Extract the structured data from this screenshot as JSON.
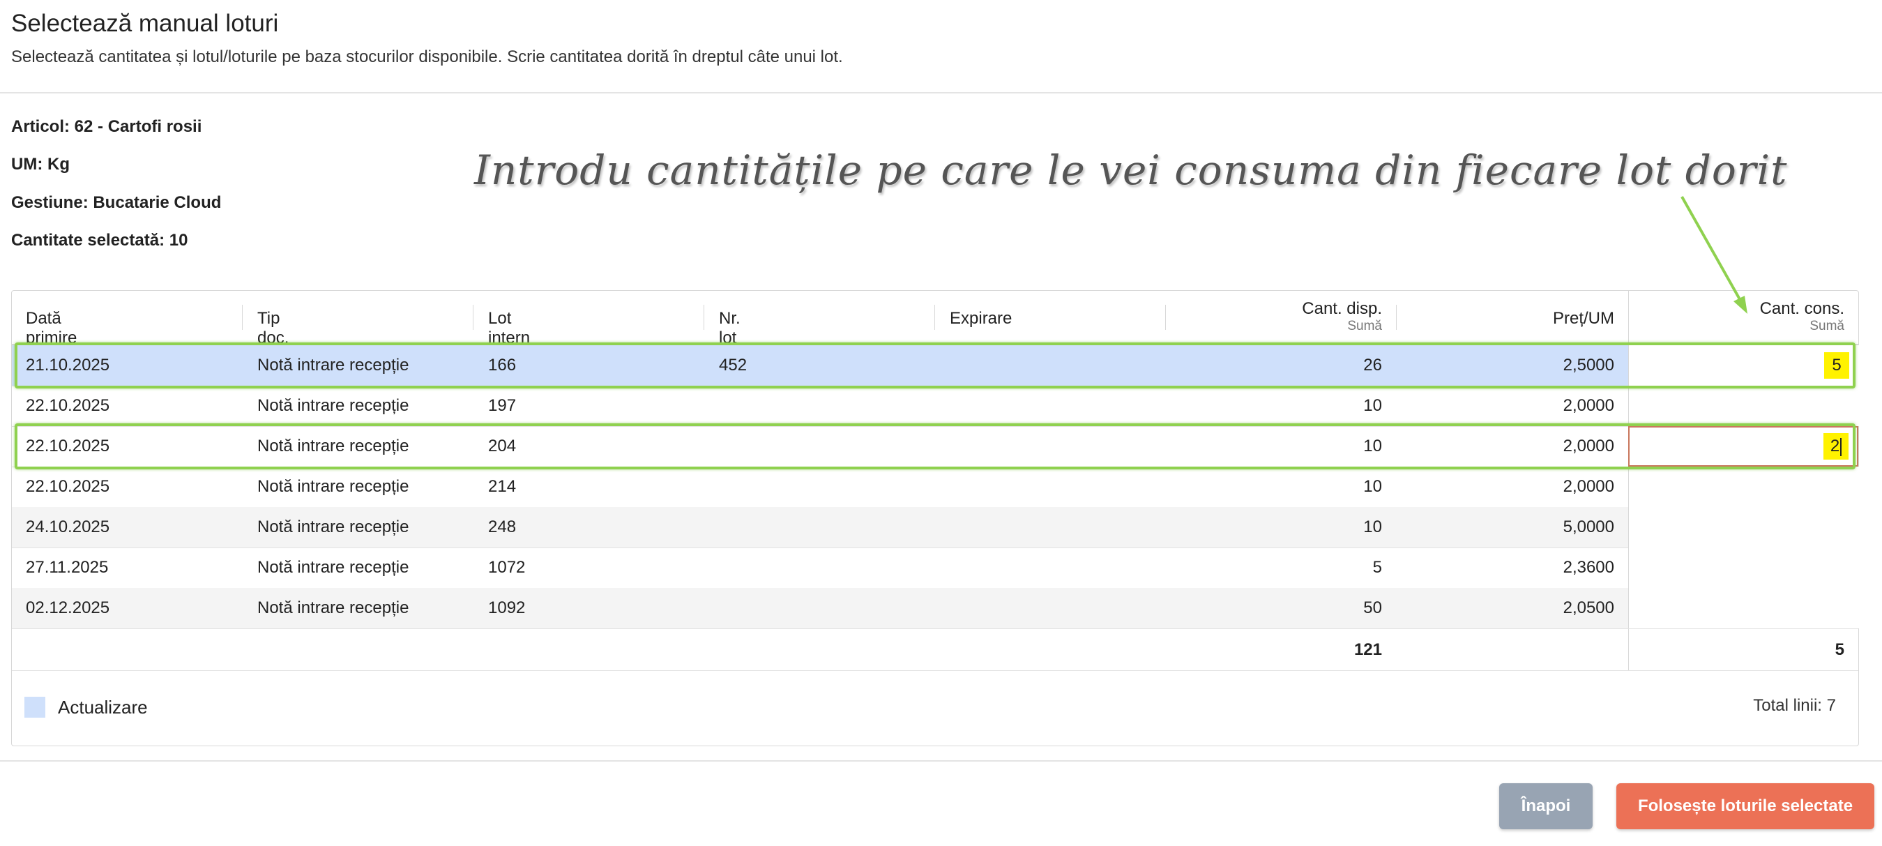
{
  "header": {
    "title": "Selectează manual loturi",
    "subtitle": "Selectează cantitatea și lotul/loturile pe baza stocurilor disponibile. Scrie cantitatea dorită în dreptul câte unui lot."
  },
  "info": {
    "articol": "Articol: 62 - Cartofi rosii",
    "um": "UM: Kg",
    "gestiune": "Gestiune: Bucatarie Cloud",
    "cantitate": "Cantitate selectată: 10"
  },
  "annotation": "Introdu cantitățile pe care le vei consuma din fiecare lot dorit",
  "table": {
    "columns": {
      "data_primire": "Dată primire",
      "tip_doc": "Tip doc.",
      "lot_intern": "Lot intern",
      "nr_lot": "Nr. lot",
      "expirare": "Expirare",
      "cant_disp": "Cant. disp.",
      "cant_disp_sub": "Sumă",
      "pret_um": "Preț/UM",
      "cant_cons": "Cant. cons.",
      "cant_cons_sub": "Sumă"
    },
    "rows": [
      {
        "data": "21.10.2025",
        "tip": "Notă intrare recepție",
        "lot": "166",
        "nr": "452",
        "exp": "",
        "disp": "26",
        "pret": "2,5000",
        "cons": "5"
      },
      {
        "data": "22.10.2025",
        "tip": "Notă intrare recepție",
        "lot": "197",
        "nr": "",
        "exp": "",
        "disp": "10",
        "pret": "2,0000",
        "cons": ""
      },
      {
        "data": "22.10.2025",
        "tip": "Notă intrare recepție",
        "lot": "204",
        "nr": "",
        "exp": "",
        "disp": "10",
        "pret": "2,0000",
        "cons": "2"
      },
      {
        "data": "22.10.2025",
        "tip": "Notă intrare recepție",
        "lot": "214",
        "nr": "",
        "exp": "",
        "disp": "10",
        "pret": "2,0000",
        "cons": ""
      },
      {
        "data": "24.10.2025",
        "tip": "Notă intrare recepție",
        "lot": "248",
        "nr": "",
        "exp": "",
        "disp": "10",
        "pret": "5,0000",
        "cons": ""
      },
      {
        "data": "27.11.2025",
        "tip": "Notă intrare recepție",
        "lot": "1072",
        "nr": "",
        "exp": "",
        "disp": "5",
        "pret": "2,3600",
        "cons": ""
      },
      {
        "data": "02.12.2025",
        "tip": "Notă intrare recepție",
        "lot": "1092",
        "nr": "",
        "exp": "",
        "disp": "50",
        "pret": "2,0500",
        "cons": ""
      }
    ],
    "totals": {
      "disp": "121",
      "cons": "5"
    }
  },
  "footer": {
    "legend_label": "Actualizare",
    "total_lines": "Total linii: 7"
  },
  "buttons": {
    "back": "Înapoi",
    "use": "Folosește loturile selectate"
  },
  "colors": {
    "selected_row": "#cfe0fb",
    "highlight": "#fff200",
    "annotation_green": "#8fd14f",
    "primary_button": "#ec7156",
    "secondary_button": "#98a4b3"
  }
}
